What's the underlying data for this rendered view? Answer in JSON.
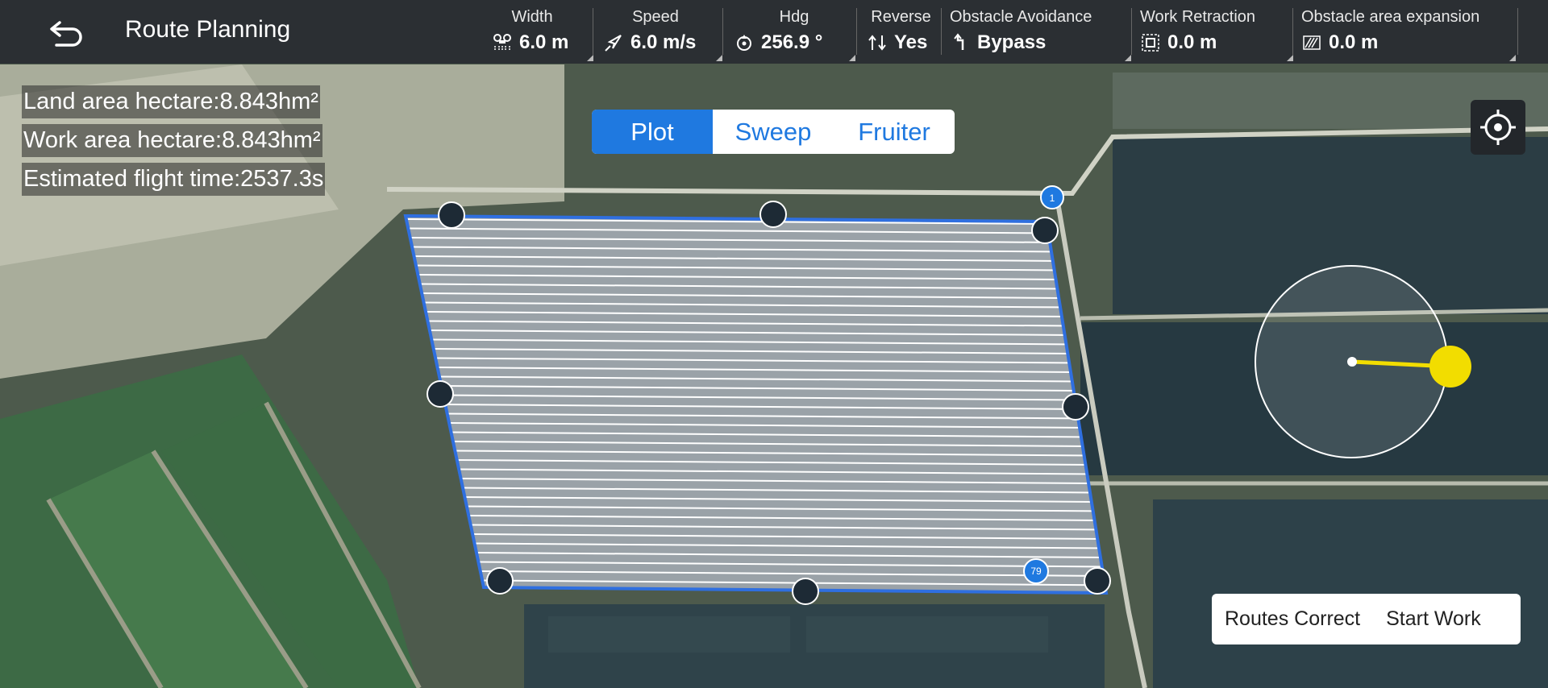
{
  "header": {
    "title": "Route Planning",
    "params": [
      {
        "label": "Width",
        "value": "6.0 m",
        "icon": "width-icon"
      },
      {
        "label": "Speed",
        "value": "6.0 m/s",
        "icon": "speed-icon"
      },
      {
        "label": "Hdg",
        "value": "256.9 °",
        "icon": "heading-icon"
      },
      {
        "label": "Reverse",
        "value": "Yes",
        "icon": "reverse-icon"
      },
      {
        "label": "Obstacle Avoidance",
        "value": "Bypass",
        "icon": "obstacle-avoidance-icon"
      },
      {
        "label": "Work Retraction",
        "value": "0.0 m",
        "icon": "work-retraction-icon"
      },
      {
        "label": "Obstacle area expansion",
        "value": "0.0 m",
        "icon": "obstacle-expansion-icon"
      }
    ]
  },
  "info": {
    "land_area": "Land area hectare:8.843hm²",
    "work_area": "Work area hectare:8.843hm²",
    "flight_time": "Estimated flight time:2537.3s"
  },
  "mode_tabs": {
    "items": [
      "Plot",
      "Sweep",
      "Fruiter"
    ],
    "selected": "Plot"
  },
  "map": {
    "route_start_marker": "1",
    "route_end_marker": "79"
  },
  "actions": {
    "routes_correct": "Routes Correct",
    "start_work": "Start Work"
  },
  "colors": {
    "accent": "#1f79e0",
    "topbar": "#2b2f33",
    "joystick_knob": "#f2dd00",
    "plot_outline": "#2f6fe0"
  }
}
